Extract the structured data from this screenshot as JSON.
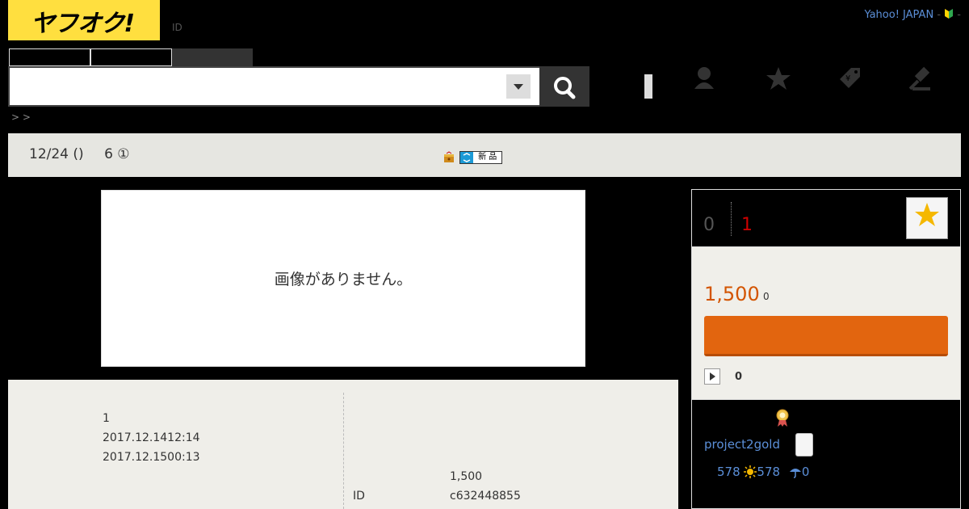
{
  "header": {
    "logo_text": "ヤフオク!",
    "id_label": "ID",
    "yahoo_link": "Yahoo! JAPAN",
    "yahoo_sep": "-",
    "beginner_sep": "-"
  },
  "search": {
    "placeholder": "",
    "select_icon": "chevron-down-icon",
    "button_icon": "search-icon"
  },
  "nav": {
    "icons": [
      "user-icon",
      "star-icon",
      "tag-icon",
      "gavel-icon"
    ]
  },
  "breadcrumb": {
    "text": "> >"
  },
  "infobar": {
    "end_date": "12/24 ()",
    "count": "6 ①",
    "new_badge": "新 品"
  },
  "image": {
    "no_image_text": "画像がありません。"
  },
  "details": {
    "left": [
      "1",
      "2017.12.1412:14",
      "2017.12.1500:13"
    ],
    "right_price": "1,500",
    "right_id_label": "ID",
    "right_id_value": "c632448855"
  },
  "panel": {
    "bid_count": "0",
    "time_left": "1",
    "price": "1,500",
    "price_tax": "0",
    "play_count": "0"
  },
  "seller": {
    "name": "project2gold",
    "rating_total": "578",
    "rating_good": "578",
    "rating_bad": "0"
  },
  "colors": {
    "brand_yellow": "#ffdf3f",
    "bid_orange": "#e2650f",
    "price_orange": "#d35400",
    "time_red": "#cc0000",
    "link_blue": "#5b8fd8"
  }
}
